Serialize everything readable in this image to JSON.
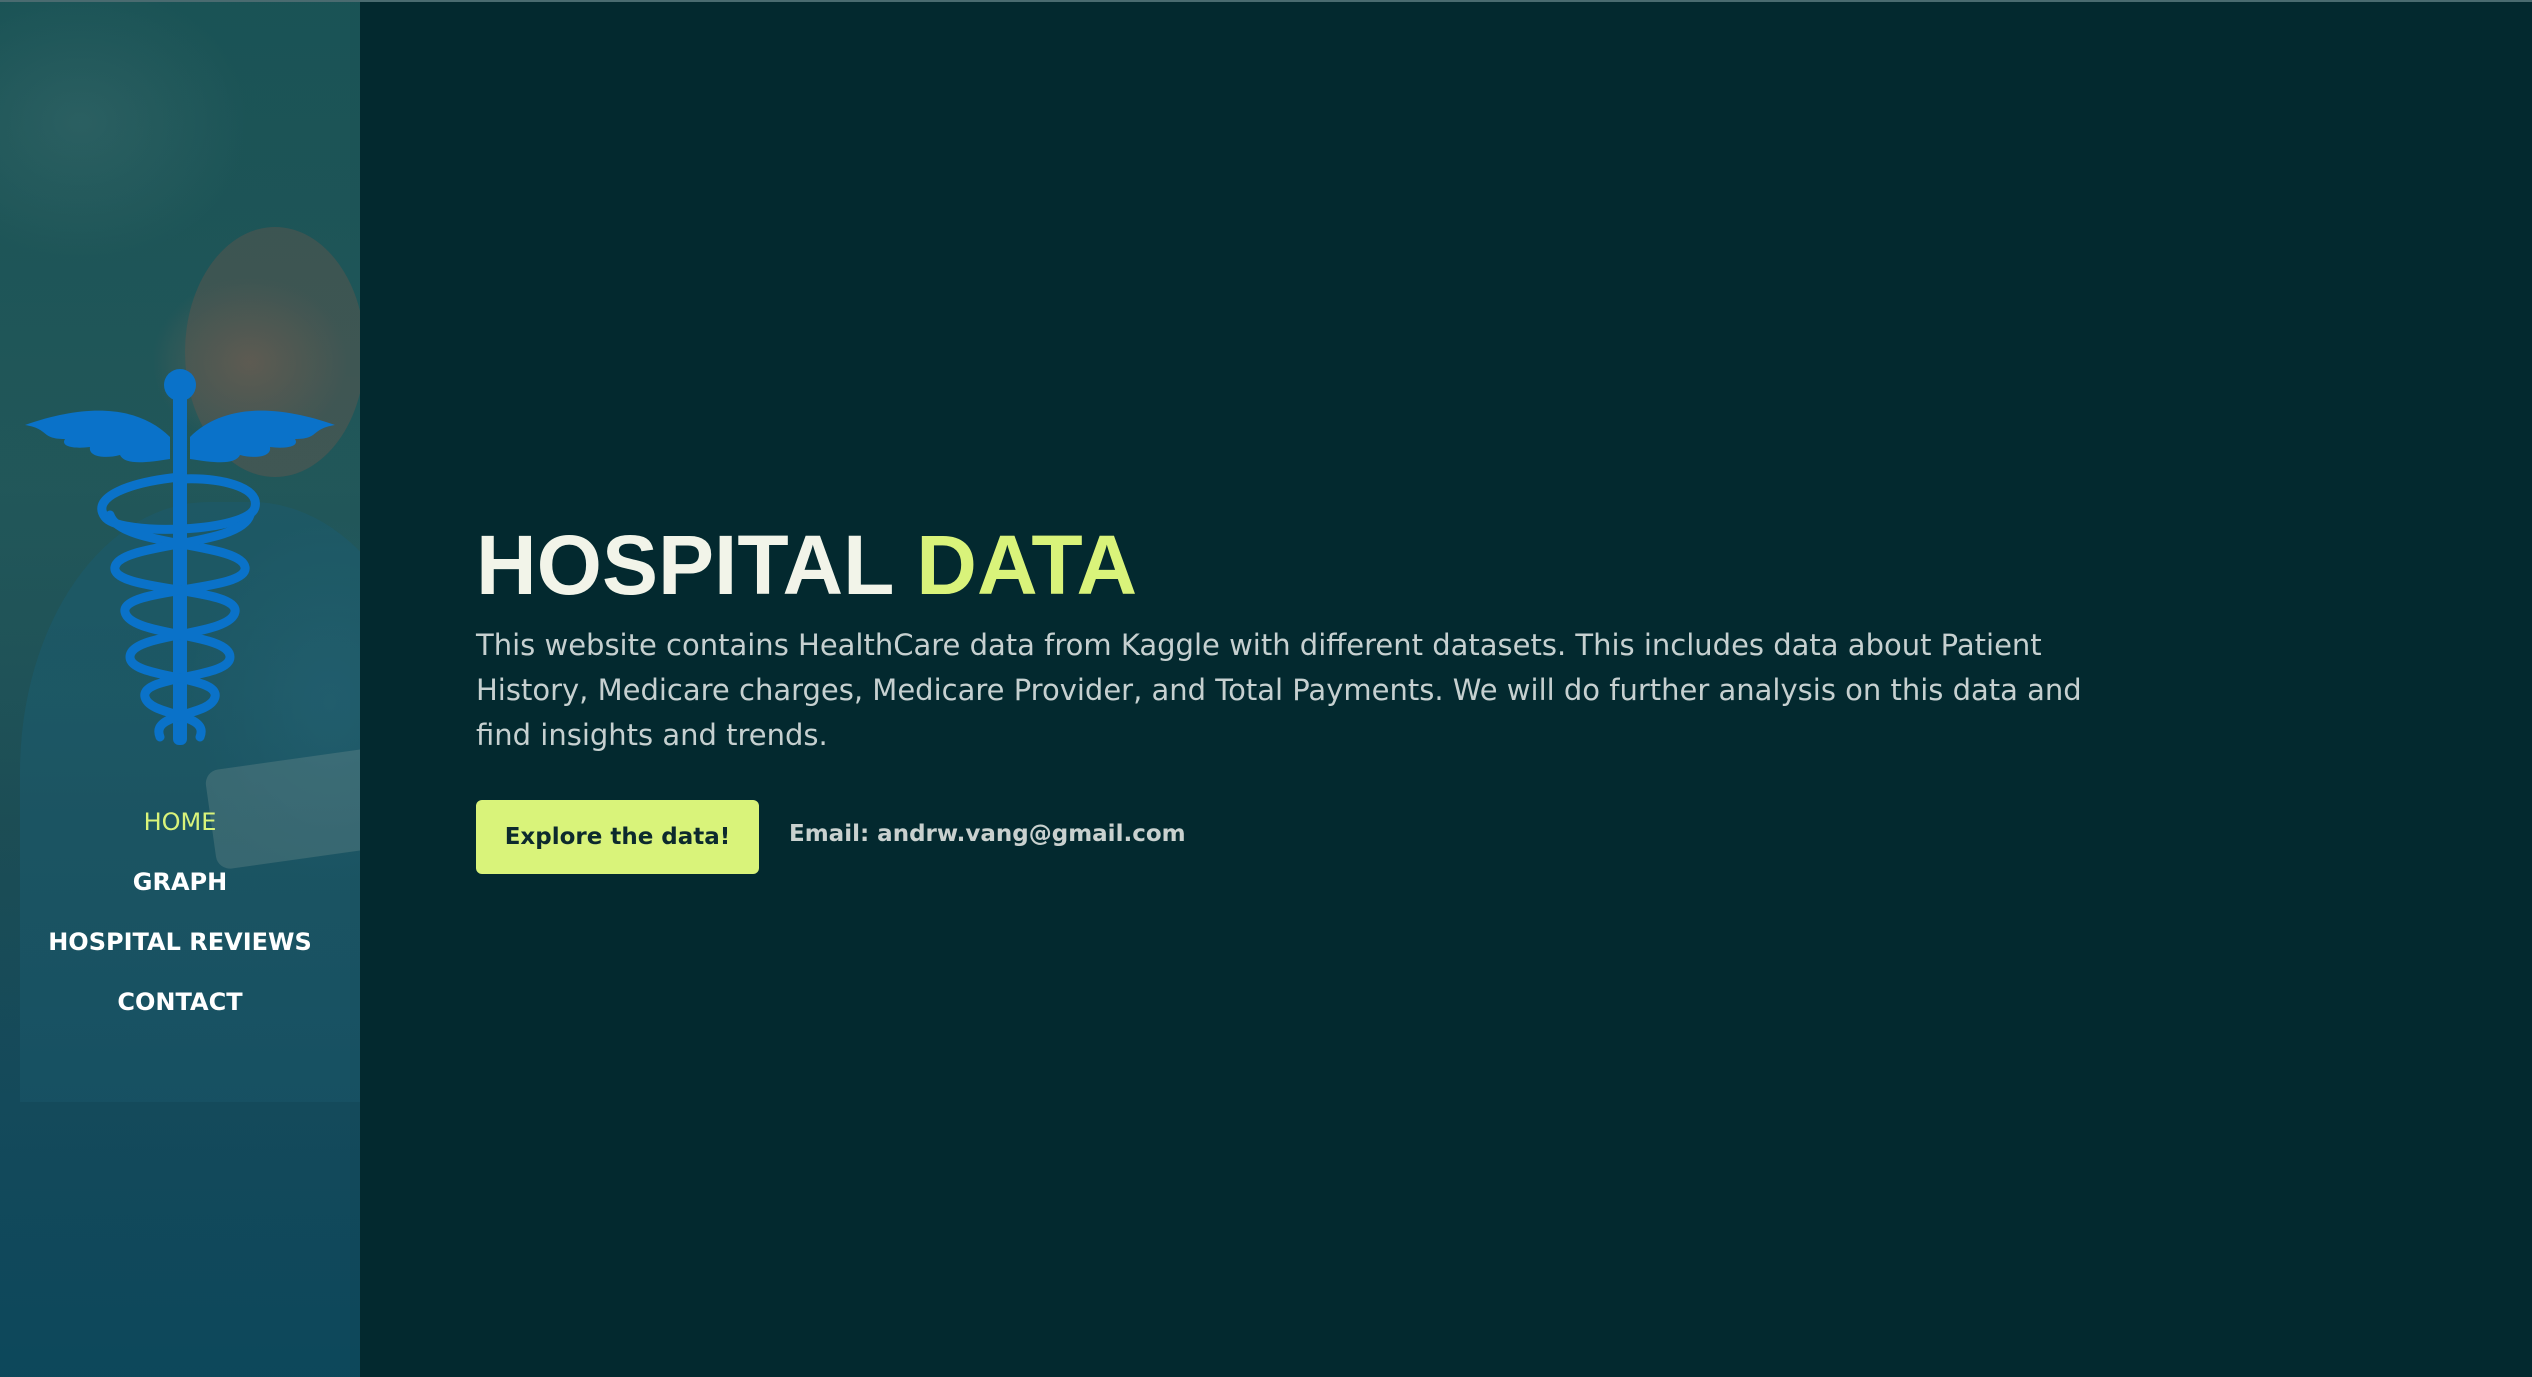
{
  "nav": {
    "items": [
      {
        "label": "HOME",
        "active": true
      },
      {
        "label": "GRAPH",
        "active": false
      },
      {
        "label": "HOSPITAL REVIEWS",
        "active": false
      },
      {
        "label": "CONTACT",
        "active": false
      }
    ]
  },
  "hero": {
    "title_main": "HOSPITAL",
    "title_accent": "DATA",
    "description": "This website contains HealthCare data from Kaggle with different datasets. This includes data about Patient History, Medicare charges, Medicare Provider, and Total Payments. We will do further analysis on this data and find insights and trends.",
    "cta_label": "Explore the data!",
    "email": "Email: andrw.vang@gmail.com"
  },
  "sidebar": {
    "logo_icon": "caduceus-icon",
    "background_image": "nurse-photo"
  },
  "colors": {
    "background": "#03292f",
    "accent": "#d9f37a",
    "logo_blue": "#0a72c9",
    "text_light": "#f2f4e9"
  }
}
